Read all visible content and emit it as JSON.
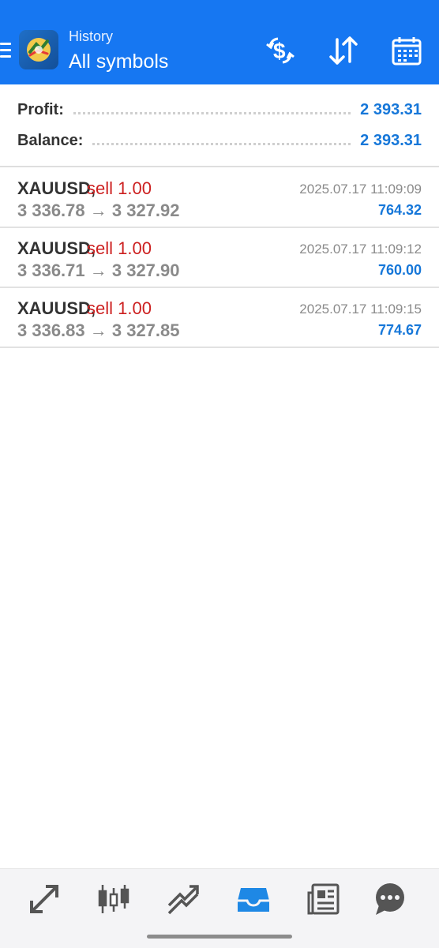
{
  "header": {
    "subtitle": "History",
    "title": "All symbols",
    "icons": [
      "menu-icon",
      "app-logo",
      "dollar-refresh-icon",
      "sort-icon",
      "calendar-icon"
    ],
    "background": "#1677f2"
  },
  "summary": {
    "profit_label": "Profit:",
    "profit_value": "2 393.31",
    "balance_label": "Balance:",
    "balance_value": "2 393.31"
  },
  "trades": [
    {
      "symbol": "XAUUSD,",
      "side": "sell 1.00",
      "prices": "3 336.78 → 3 327.92",
      "time": "2025.07.17 11:09:09",
      "profit": "764.32"
    },
    {
      "symbol": "XAUUSD,",
      "side": "sell 1.00",
      "prices": "3 336.71 → 3 327.90",
      "time": "2025.07.17 11:09:12",
      "profit": "760.00"
    },
    {
      "symbol": "XAUUSD,",
      "side": "sell 1.00",
      "prices": "3 336.83 → 3 327.85",
      "time": "2025.07.17 11:09:15",
      "profit": "774.67"
    }
  ],
  "colors": {
    "accent": "#1677f2",
    "sell": "#cc1f1f",
    "profit": "#1677d9",
    "active_nav": "#1e88e5",
    "inactive_nav": "#555555"
  },
  "bottom_nav": {
    "items": [
      "quotes-icon",
      "chart-icon",
      "trade-icon",
      "history-icon",
      "news-icon",
      "chat-icon"
    ],
    "active": "history-icon"
  }
}
